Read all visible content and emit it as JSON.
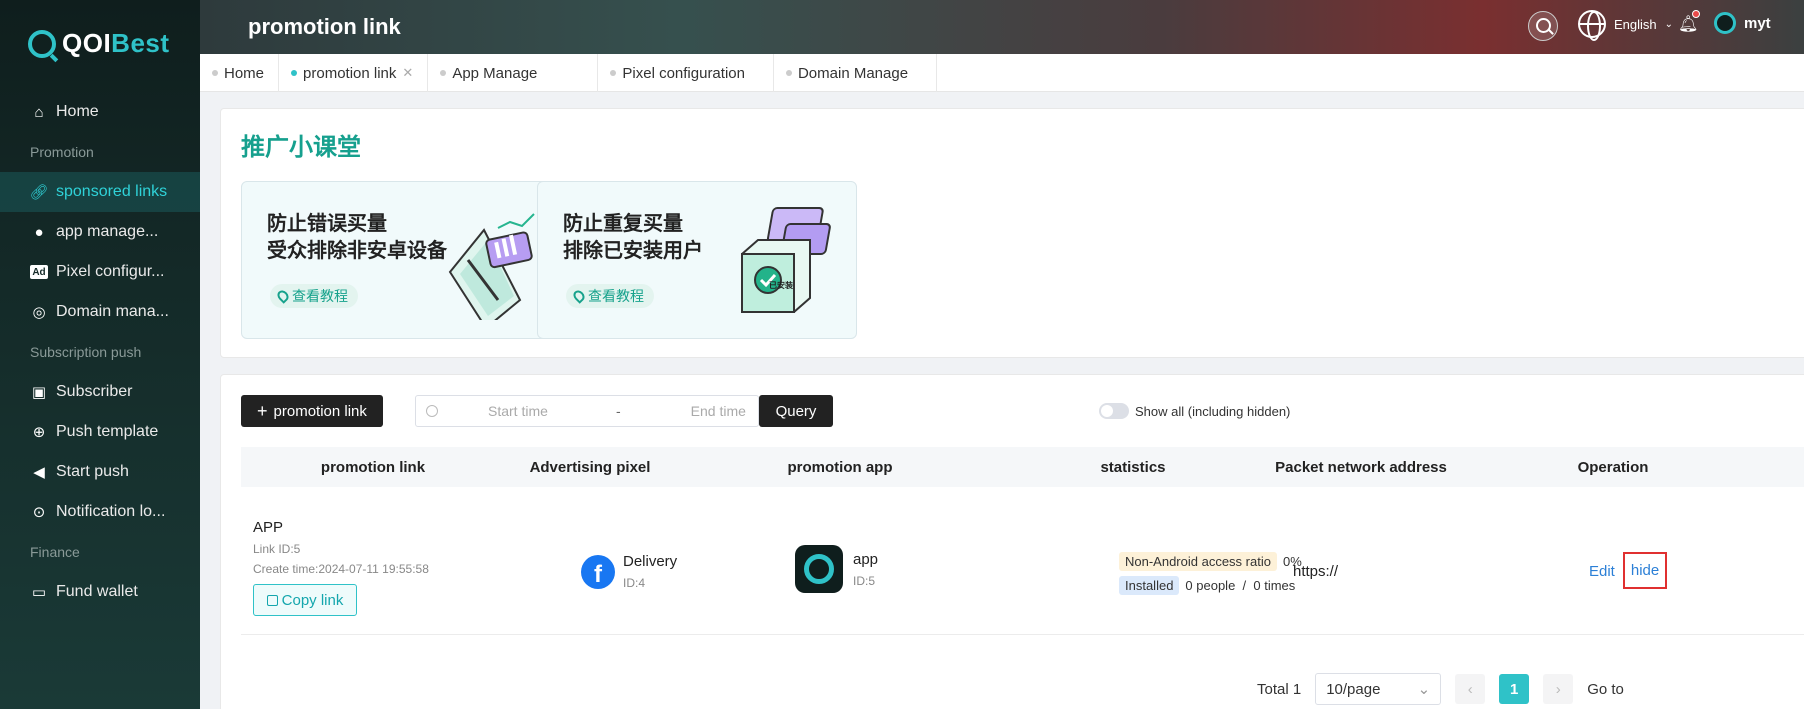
{
  "brand": {
    "name_a": "QOI",
    "name_b": "Best"
  },
  "sidebar": {
    "items": [
      {
        "label": "Home",
        "icon": "home-icon"
      },
      {
        "label": "Promotion",
        "group": true
      },
      {
        "label": "sponsored links",
        "icon": "link-icon",
        "active": true
      },
      {
        "label": "app manage...",
        "icon": "apple-icon"
      },
      {
        "label": "Pixel configur...",
        "icon": "ad-icon"
      },
      {
        "label": "Domain mana...",
        "icon": "globe-icon"
      },
      {
        "label": "Subscription push",
        "group": true
      },
      {
        "label": "Subscriber",
        "icon": "subscriber-icon"
      },
      {
        "label": "Push template",
        "icon": "upload-icon"
      },
      {
        "label": "Start push",
        "icon": "megaphone-icon"
      },
      {
        "label": "Notification lo...",
        "icon": "search-log-icon"
      },
      {
        "label": "Finance",
        "group": true
      },
      {
        "label": "Fund wallet",
        "icon": "wallet-icon"
      }
    ]
  },
  "header": {
    "title": "promotion link",
    "language": "English",
    "user": "myt"
  },
  "tabs": [
    {
      "label": "Home"
    },
    {
      "label": "promotion link",
      "active": true
    },
    {
      "label": "App Manage"
    },
    {
      "label": "Pixel configuration"
    },
    {
      "label": "Domain Manage"
    }
  ],
  "classroom": {
    "title": "推广小课堂",
    "cards": [
      {
        "line1": "防止错误买量",
        "line2": "受众排除非安卓设备",
        "link": "查看教程"
      },
      {
        "line1": "防止重复买量",
        "line2": "排除已安装用户",
        "link": "查看教程",
        "badge": "已安装"
      }
    ]
  },
  "toolbar": {
    "add_label": "promotion link",
    "start_placeholder": "Start time",
    "end_placeholder": "End time",
    "query_label": "Query",
    "toggle_label": "Show all (including hidden)"
  },
  "table": {
    "columns": [
      "promotion link",
      "Advertising pixel",
      "promotion app",
      "statistics",
      "Packet network address",
      "Operation"
    ],
    "row": {
      "name": "APP",
      "link_id": "Link ID:5",
      "create_time": "Create time:2024-07-11 19:55:58",
      "copy_label": "Copy link",
      "pixel_name": "Delivery",
      "pixel_id": "ID:4",
      "app_name": "app",
      "app_id": "ID:5",
      "stat_tag1": "Non-Android access ratio",
      "stat_val1": "0%",
      "stat_tag2": "Installed",
      "stat_val2": "0 people  /  0 times",
      "address": "https://",
      "edit_label": "Edit",
      "hide_label": "hide"
    }
  },
  "pager": {
    "total": "Total 1",
    "page_size": "10/page",
    "current": "1",
    "goto": "Go to"
  }
}
